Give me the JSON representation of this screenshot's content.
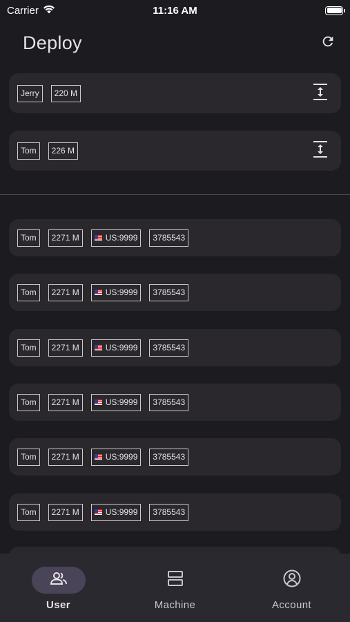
{
  "status_bar": {
    "carrier": "Carrier",
    "time": "11:16 AM"
  },
  "header": {
    "title": "Deploy",
    "refresh_icon": "refresh-icon"
  },
  "top_cards": [
    {
      "name": "Jerry",
      "size": "220 M",
      "icon": "expand-vertical-icon"
    },
    {
      "name": "Tom",
      "size": "226 M",
      "icon": "expand-vertical-icon"
    }
  ],
  "list_items": [
    {
      "name": "Tom",
      "size": "2271 M",
      "region": "US:9999",
      "id": "3785543",
      "flag": "us-flag-icon"
    },
    {
      "name": "Tom",
      "size": "2271 M",
      "region": "US:9999",
      "id": "3785543",
      "flag": "us-flag-icon"
    },
    {
      "name": "Tom",
      "size": "2271 M",
      "region": "US:9999",
      "id": "3785543",
      "flag": "us-flag-icon"
    },
    {
      "name": "Tom",
      "size": "2271 M",
      "region": "US:9999",
      "id": "3785543",
      "flag": "us-flag-icon"
    },
    {
      "name": "Tom",
      "size": "2271 M",
      "region": "US:9999",
      "id": "3785543",
      "flag": "us-flag-icon"
    },
    {
      "name": "Tom",
      "size": "2271 M",
      "region": "US:9999",
      "id": "3785543",
      "flag": "us-flag-icon"
    }
  ],
  "bottom_nav": [
    {
      "label": "User",
      "icon": "users-icon",
      "active": true
    },
    {
      "label": "Machine",
      "icon": "server-icon",
      "active": false
    },
    {
      "label": "Account",
      "icon": "account-circle-icon",
      "active": false
    }
  ],
  "colors": {
    "background": "#1c1b1f",
    "card": "#2a282d",
    "nav": "#2b2930",
    "nav_active_pill": "#4a4458"
  }
}
